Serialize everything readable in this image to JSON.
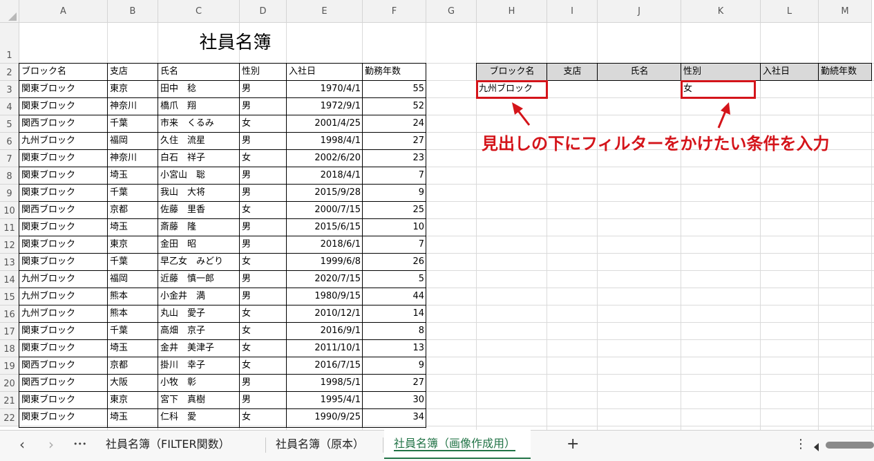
{
  "columns": [
    "A",
    "B",
    "C",
    "D",
    "E",
    "F",
    "G",
    "H",
    "I",
    "J",
    "K",
    "L",
    "M"
  ],
  "rows": [
    "1",
    "2",
    "3",
    "4",
    "5",
    "6",
    "7",
    "8",
    "9",
    "10",
    "11",
    "12",
    "13",
    "14",
    "15",
    "16",
    "17",
    "18",
    "19",
    "20",
    "21",
    "22"
  ],
  "title": "社員名簿",
  "table": {
    "headers": [
      "ブロック名",
      "支店",
      "氏名",
      "性別",
      "入社日",
      "勤務年数"
    ],
    "records": [
      [
        "関東ブロック",
        "東京",
        "田中　稔",
        "男",
        "1970/4/1",
        "55"
      ],
      [
        "関東ブロック",
        "神奈川",
        "橋爪　翔",
        "男",
        "1972/9/1",
        "52"
      ],
      [
        "関西ブロック",
        "千葉",
        "市来　くるみ",
        "女",
        "2001/4/25",
        "24"
      ],
      [
        "九州ブロック",
        "福岡",
        "久住　流星",
        "男",
        "1998/4/1",
        "27"
      ],
      [
        "関東ブロック",
        "神奈川",
        "白石　祥子",
        "女",
        "2002/6/20",
        "23"
      ],
      [
        "関東ブロック",
        "埼玉",
        "小宮山　聡",
        "男",
        "2018/4/1",
        "7"
      ],
      [
        "関東ブロック",
        "千葉",
        "我山　大将",
        "男",
        "2015/9/28",
        "9"
      ],
      [
        "関西ブロック",
        "京都",
        "佐藤　里香",
        "女",
        "2000/7/15",
        "25"
      ],
      [
        "関東ブロック",
        "埼玉",
        "斎藤　隆",
        "男",
        "2015/6/15",
        "10"
      ],
      [
        "関東ブロック",
        "東京",
        "金田　昭",
        "男",
        "2018/6/1",
        "7"
      ],
      [
        "関東ブロック",
        "千葉",
        "早乙女　みどり",
        "女",
        "1999/6/8",
        "26"
      ],
      [
        "九州ブロック",
        "福岡",
        "近藤　慎一郎",
        "男",
        "2020/7/15",
        "5"
      ],
      [
        "九州ブロック",
        "熊本",
        "小金井　満",
        "男",
        "1980/9/15",
        "44"
      ],
      [
        "九州ブロック",
        "熊本",
        "丸山　愛子",
        "女",
        "2010/12/1",
        "14"
      ],
      [
        "関東ブロック",
        "千葉",
        "高畑　京子",
        "女",
        "2016/9/1",
        "8"
      ],
      [
        "関東ブロック",
        "埼玉",
        "金井　美津子",
        "女",
        "2011/10/1",
        "13"
      ],
      [
        "関西ブロック",
        "京都",
        "掛川　幸子",
        "女",
        "2016/7/15",
        "9"
      ],
      [
        "関西ブロック",
        "大阪",
        "小牧　彰",
        "男",
        "1998/5/1",
        "27"
      ],
      [
        "関東ブロック",
        "東京",
        "宮下　真樹",
        "男",
        "1995/4/1",
        "30"
      ],
      [
        "関東ブロック",
        "埼玉",
        "仁科　愛",
        "女",
        "1990/9/25",
        "34"
      ]
    ]
  },
  "criteria": {
    "headers": [
      "ブロック名",
      "支店",
      "氏名",
      "性別",
      "入社日",
      "勤続年数"
    ],
    "values": [
      "九州ブロック",
      "",
      "",
      "女",
      "",
      ""
    ]
  },
  "annotation": "見出しの下にフィルターをかけたい条件を入力",
  "colors": {
    "accent": "#d4141a",
    "header_fill": "#d9d9d9",
    "tab_active": "#217346"
  },
  "sheet_tabs": {
    "prev": "‹",
    "next": "›",
    "more": "•••",
    "items": [
      "社員名簿（FILTER関数）",
      "社員名簿（原本）",
      "社員名簿（画像作成用）"
    ],
    "active": 2,
    "add": "+",
    "options": "⋮"
  }
}
